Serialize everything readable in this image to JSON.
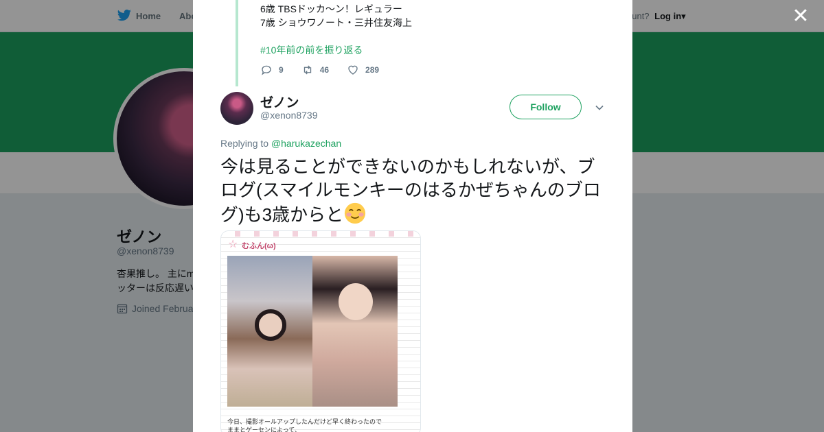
{
  "nav": {
    "home_label": "Home",
    "about_label": "Abo",
    "account_prompt": "ccount?",
    "login_label": "Log in"
  },
  "profile": {
    "name": "ゼノン",
    "handle": "@xenon8739",
    "bio_line1": "杏果推し。 主にm",
    "bio_line2": "ッターは反応遅い",
    "joined": "Joined Februa"
  },
  "prev_tweet": {
    "line1": "6歳 TBSドッカ〜ン！レギュラー",
    "line2": "7歳 ショウワノート・三井住友海上",
    "hashtag": "#10年前の前を振り返る",
    "replies": "9",
    "retweets": "46",
    "likes": "289"
  },
  "tweet": {
    "name": "ゼノン",
    "handle": "@xenon8739",
    "follow_label": "Follow",
    "replying_prefix": "Replying to",
    "replying_to": "@harukazechan",
    "text": "今は見ることができないのかもしれないが、ブログ(スマイルモンキーのはるかぜちゃんのブログ)も3歳からと"
  },
  "media": {
    "caption": "むふん(ω)",
    "text_line1": "今日、撮影オールアップしたんだけど早く終わったので",
    "text_line2": "ままとゲーセンによって、"
  },
  "colors": {
    "accent": "#1da15f",
    "banner": "#1da15f",
    "text": "#14171a",
    "muted": "#657786"
  }
}
